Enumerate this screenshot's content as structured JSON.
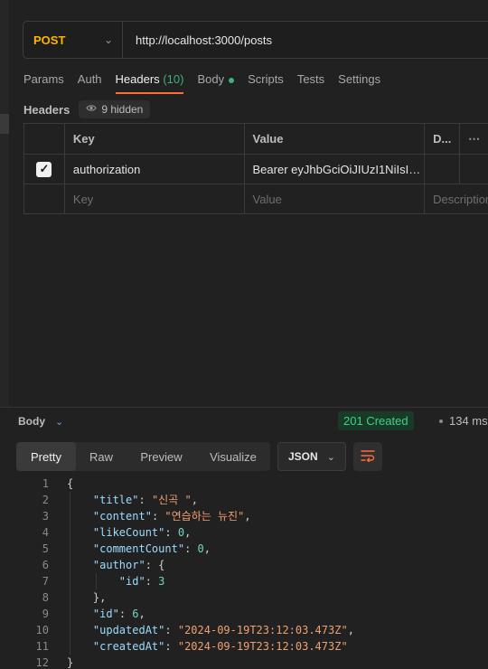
{
  "request": {
    "method": "POST",
    "url": "http://localhost:3000/posts"
  },
  "tabs": [
    {
      "label": "Params"
    },
    {
      "label": "Auth"
    },
    {
      "label": "Headers",
      "count": "(10)"
    },
    {
      "label": "Body"
    },
    {
      "label": "Scripts"
    },
    {
      "label": "Tests"
    },
    {
      "label": "Settings"
    }
  ],
  "headers_section": {
    "title": "Headers",
    "hidden_label": "9 hidden"
  },
  "table": {
    "columns": [
      "Key",
      "Value",
      "D...",
      "⋯"
    ],
    "rows": [
      {
        "key": "authorization",
        "value": "Bearer eyJhbGciOiJIUzI1NiIsIn...",
        "checked": true
      }
    ],
    "placeholder": {
      "key": "Key",
      "value": "Value",
      "description": "Description"
    }
  },
  "response": {
    "title": "Body",
    "status": "201 Created",
    "time": "134 ms",
    "view_tabs": [
      "Pretty",
      "Raw",
      "Preview",
      "Visualize"
    ],
    "format": "JSON",
    "lines": [
      "1",
      "2",
      "3",
      "4",
      "5",
      "6",
      "7",
      "8",
      "9",
      "10",
      "11",
      "12"
    ],
    "json": {
      "open": "{",
      "close": "}",
      "title_key": "\"title\"",
      "title_val": "\"신곡 \"",
      "content_key": "\"content\"",
      "content_val": "\"연습하는 뉴진\"",
      "likeCount_key": "\"likeCount\"",
      "likeCount_val": "0",
      "commentCount_key": "\"commentCount\"",
      "commentCount_val": "0",
      "author_key": "\"author\"",
      "author_open": "{",
      "author_id_key": "\"id\"",
      "author_id_val": "3",
      "author_close": "},",
      "id_key": "\"id\"",
      "id_val": "6",
      "updatedAt_key": "\"updatedAt\"",
      "updatedAt_val": "\"2024-09-19T23:12:03.473Z\"",
      "createdAt_key": "\"createdAt\"",
      "createdAt_val": "\"2024-09-19T23:12:03.473Z\""
    }
  },
  "colors": {
    "method": "#ffb400",
    "accent": "#ff6c37",
    "status_ok": "#3fd08a"
  }
}
